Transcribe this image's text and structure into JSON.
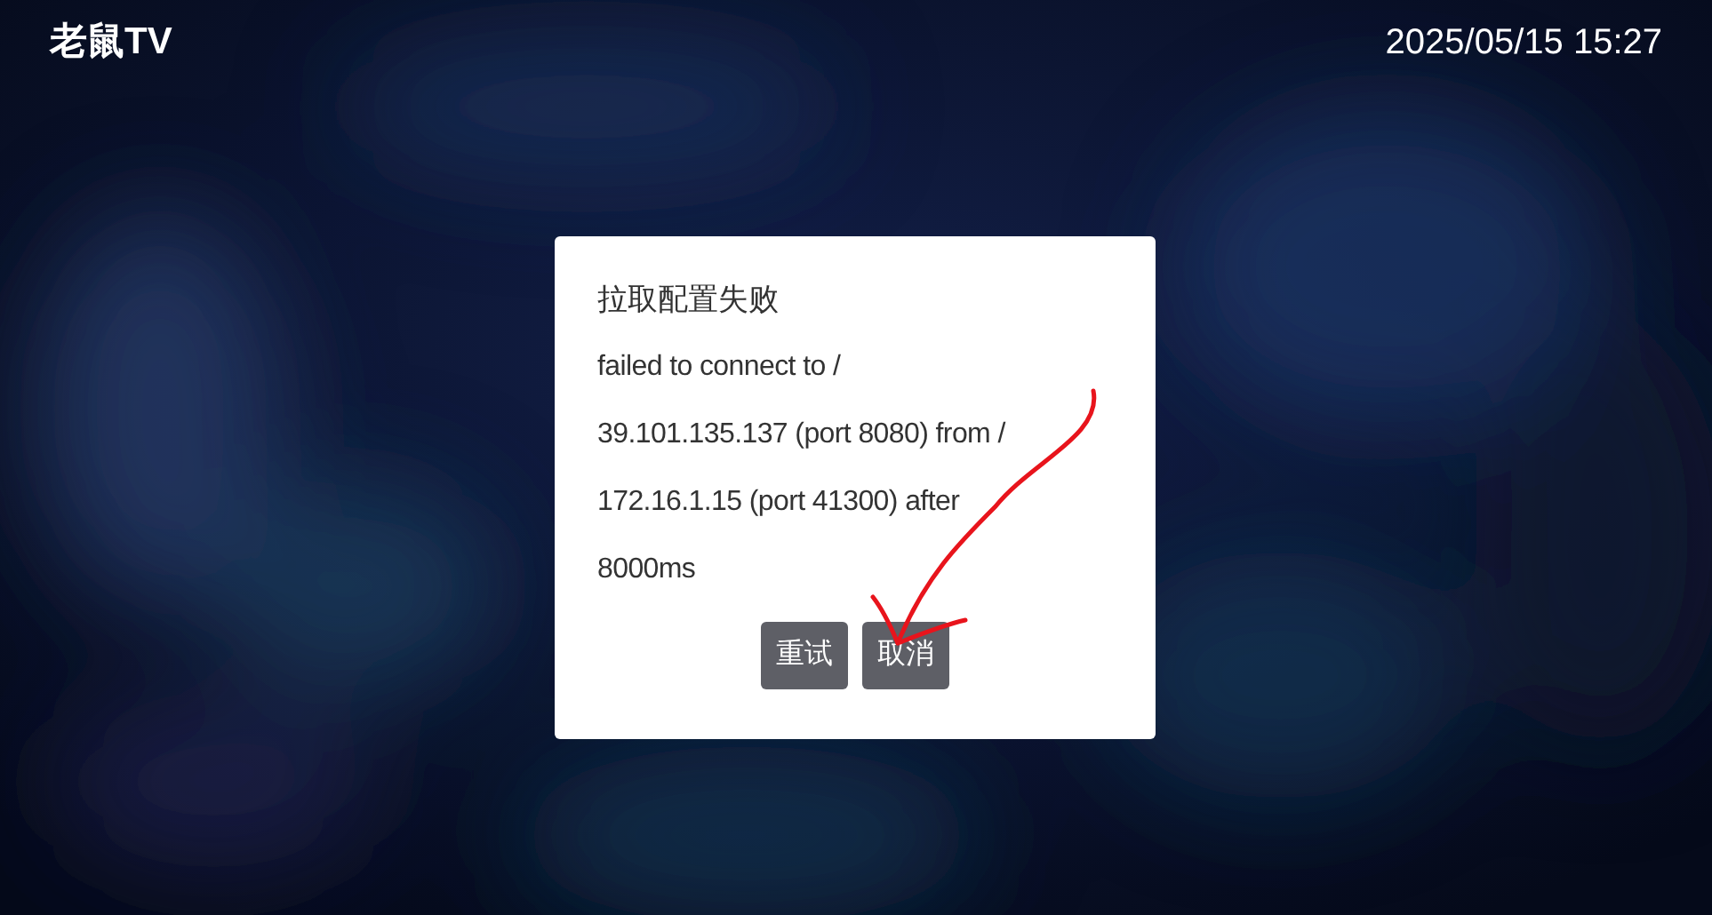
{
  "header": {
    "app_title": "老鼠TV",
    "datetime": "2025/05/15 15:27"
  },
  "dialog": {
    "title": "拉取配置失败",
    "message_lines": [
      "failed to connect to /",
      "39.101.135.137 (port 8080) from /",
      "172.16.1.15 (port 41300) after",
      "8000ms"
    ],
    "buttons": [
      {
        "label": "重试"
      },
      {
        "label": "取消"
      }
    ]
  },
  "annotation": {
    "kind": "arrow",
    "color": "#e8141c"
  }
}
